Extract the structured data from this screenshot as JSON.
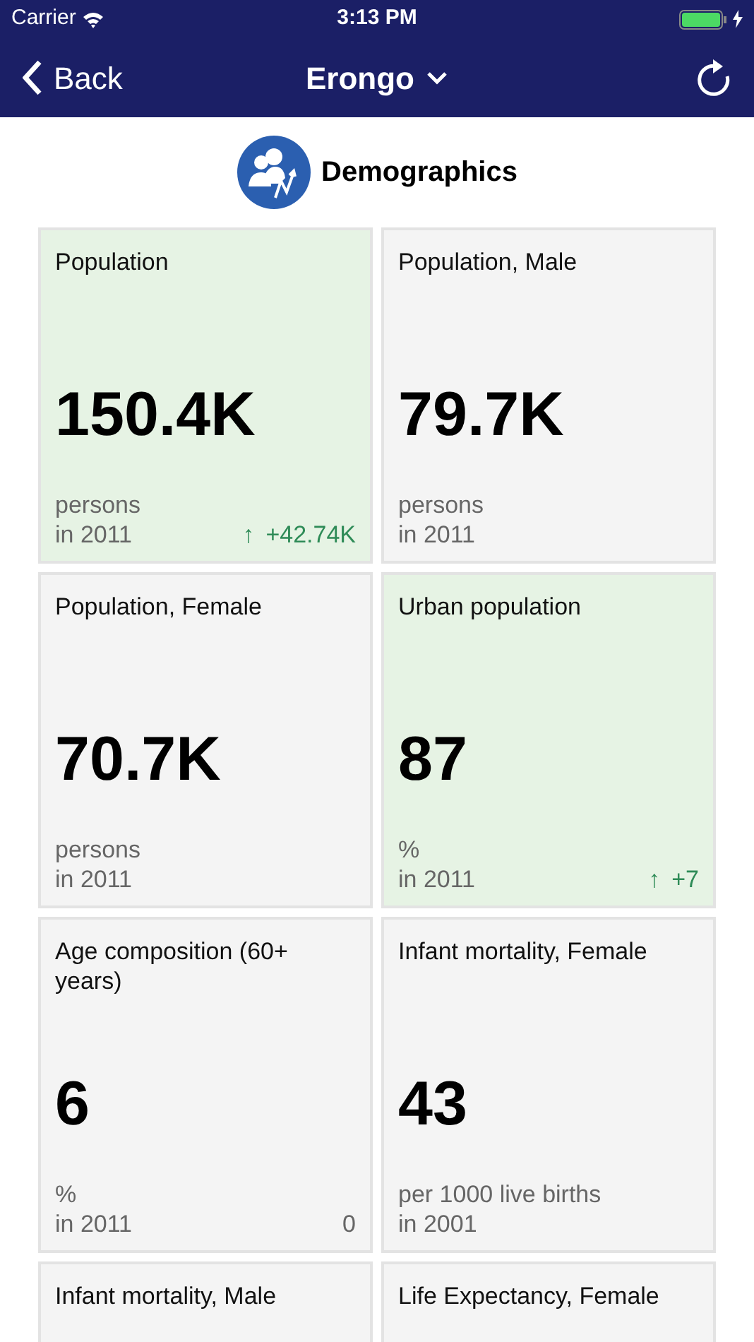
{
  "status_bar": {
    "carrier": "Carrier",
    "time": "3:13 PM"
  },
  "nav": {
    "back": "Back",
    "title": "Erongo"
  },
  "section": {
    "title": "Demographics"
  },
  "cards": [
    {
      "title": "Population",
      "value": "150.4K",
      "unit": "persons",
      "period": "in 2011",
      "highlighted": true,
      "change": {
        "kind": "up",
        "arrow": "↑",
        "text": "+42.74K"
      }
    },
    {
      "title": "Population, Male",
      "value": "79.7K",
      "unit": "persons",
      "period": "in 2011",
      "highlighted": false
    },
    {
      "title": "Population, Female",
      "value": "70.7K",
      "unit": "persons",
      "period": "in 2011",
      "highlighted": false
    },
    {
      "title": "Urban population",
      "value": "87",
      "unit": "%",
      "period": "in 2011",
      "highlighted": true,
      "change": {
        "kind": "up",
        "arrow": "↑",
        "text": "+7"
      }
    },
    {
      "title": "Age composition (60+ years)",
      "value": "6",
      "unit": "%",
      "period": "in 2011",
      "highlighted": false,
      "change": {
        "kind": "flat",
        "text": "0"
      }
    },
    {
      "title": "Infant mortality, Female",
      "value": "43",
      "unit": "per 1000 live births",
      "period": "in 2001",
      "highlighted": false
    },
    {
      "title": "Infant mortality, Male",
      "highlighted": false
    },
    {
      "title": "Life Expectancy, Female",
      "highlighted": false
    }
  ]
}
